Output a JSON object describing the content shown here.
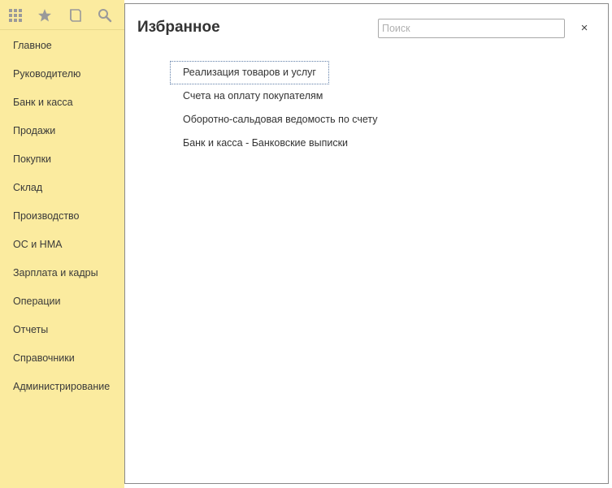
{
  "toolbar": {
    "icons": [
      "apps-grid-icon",
      "star-icon",
      "history-icon",
      "search-icon"
    ]
  },
  "sidebar": {
    "items": [
      {
        "label": "Главное"
      },
      {
        "label": "Руководителю"
      },
      {
        "label": "Банк и касса"
      },
      {
        "label": "Продажи"
      },
      {
        "label": "Покупки"
      },
      {
        "label": "Склад"
      },
      {
        "label": "Производство"
      },
      {
        "label": "ОС и НМА"
      },
      {
        "label": "Зарплата и кадры"
      },
      {
        "label": "Операции"
      },
      {
        "label": "Отчеты"
      },
      {
        "label": "Справочники"
      },
      {
        "label": "Администрирование"
      }
    ]
  },
  "panel": {
    "title": "Избранное",
    "search_placeholder": "Поиск",
    "search_value": "",
    "close_glyph": "×",
    "favorites": [
      {
        "label": "Реализация товаров и услуг",
        "focused": true
      },
      {
        "label": "Счета на оплату покупателям",
        "focused": false
      },
      {
        "label": "Оборотно-сальдовая ведомость по счету",
        "focused": false
      },
      {
        "label": "Банк и касса - Банковские выписки",
        "focused": false
      }
    ]
  },
  "colors": {
    "sidebar_bg": "#fbeb9f",
    "panel_border": "#8a8a8a",
    "focus_border": "#5f7ea8"
  }
}
